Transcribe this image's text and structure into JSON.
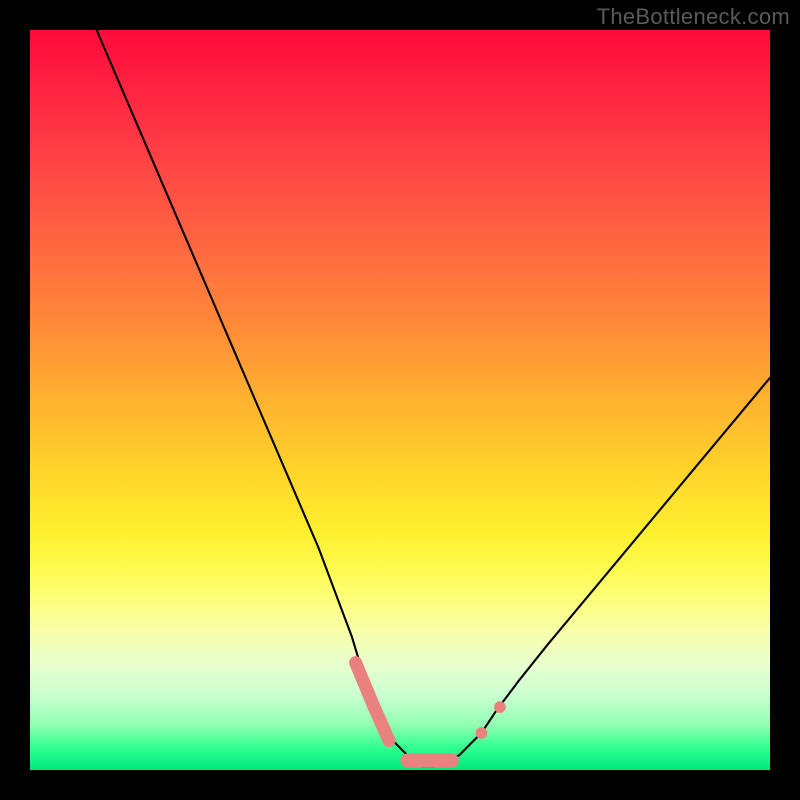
{
  "watermark": "TheBottleneck.com",
  "chart_data": {
    "type": "line",
    "title": "",
    "xlabel": "",
    "ylabel": "",
    "xlim": [
      0,
      100
    ],
    "ylim": [
      0,
      100
    ],
    "grid": false,
    "legend": false,
    "series": [
      {
        "name": "bottleneck-curve",
        "x": [
          9,
          12,
          15,
          18,
          21,
          24,
          27,
          30,
          33,
          36,
          39,
          42,
          43.5,
          45,
          48,
          49,
          51,
          52,
          53,
          54.5,
          56,
          58,
          60,
          61,
          63,
          66,
          70,
          75,
          80,
          85,
          90,
          95,
          100
        ],
        "values": [
          100,
          93,
          86,
          79,
          72,
          65,
          58,
          51,
          44,
          37,
          30,
          22,
          18,
          13,
          6,
          4,
          2,
          1,
          0.5,
          0.5,
          1,
          2,
          4,
          5,
          8,
          12,
          17,
          23,
          29,
          35,
          41,
          47,
          53
        ]
      }
    ],
    "markers": [
      {
        "name": "highlight-left-upper",
        "x": 44,
        "y": 14.5,
        "r": 1.0
      },
      {
        "name": "highlight-left-mid",
        "x": 46.5,
        "y": 8.5,
        "r": 1.0
      },
      {
        "name": "highlight-left-lower",
        "x": 48.5,
        "y": 4,
        "r": 1.0
      },
      {
        "name": "highlight-flat-1",
        "x": 51,
        "y": 1.3,
        "r": 1.0
      },
      {
        "name": "highlight-flat-2",
        "x": 53,
        "y": 0.8,
        "r": 1.0
      },
      {
        "name": "highlight-flat-3",
        "x": 55,
        "y": 0.8,
        "r": 1.0
      },
      {
        "name": "highlight-flat-4",
        "x": 57,
        "y": 1.3,
        "r": 1.0
      },
      {
        "name": "highlight-right-lower",
        "x": 61,
        "y": 5,
        "r": 0.9
      },
      {
        "name": "highlight-right-upper",
        "x": 63.5,
        "y": 8.5,
        "r": 0.9
      }
    ],
    "colors": {
      "curve": "#000000",
      "markers": "#e9827f",
      "gradient_top": "#ff0a3a",
      "gradient_bottom": "#00e97f"
    }
  }
}
